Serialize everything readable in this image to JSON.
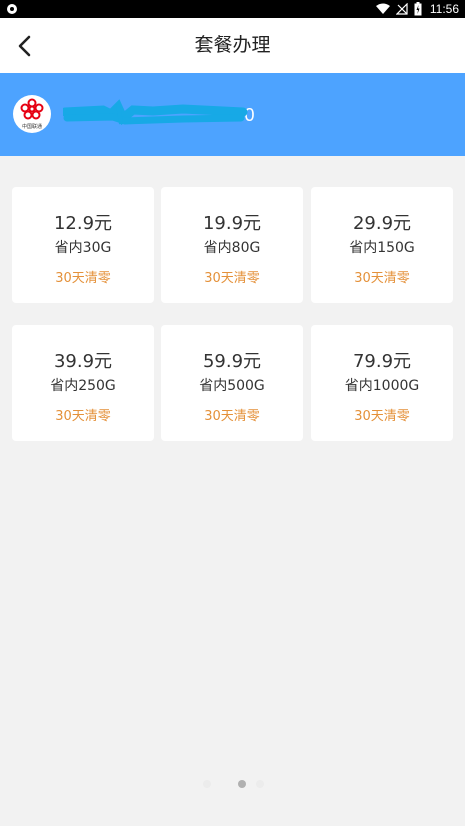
{
  "status_bar": {
    "time": "11:56"
  },
  "nav": {
    "title": "套餐办理"
  },
  "account": {
    "logo_caption": "中国联通",
    "phone_visible": "0000"
  },
  "packages": [
    {
      "price": "12.9元",
      "data": "省内30G",
      "reset": "30天清零"
    },
    {
      "price": "19.9元",
      "data": "省内80G",
      "reset": "30天清零"
    },
    {
      "price": "29.9元",
      "data": "省内150G",
      "reset": "30天清零"
    },
    {
      "price": "39.9元",
      "data": "省内250G",
      "reset": "30天清零"
    },
    {
      "price": "59.9元",
      "data": "省内500G",
      "reset": "30天清零"
    },
    {
      "price": "79.9元",
      "data": "省内1000G",
      "reset": "30天清零"
    }
  ],
  "pager": {
    "pages": 3,
    "active": 2
  },
  "colors": {
    "header": "#4da3ff",
    "accent": "#e4913a",
    "background": "#f2f2f2"
  }
}
